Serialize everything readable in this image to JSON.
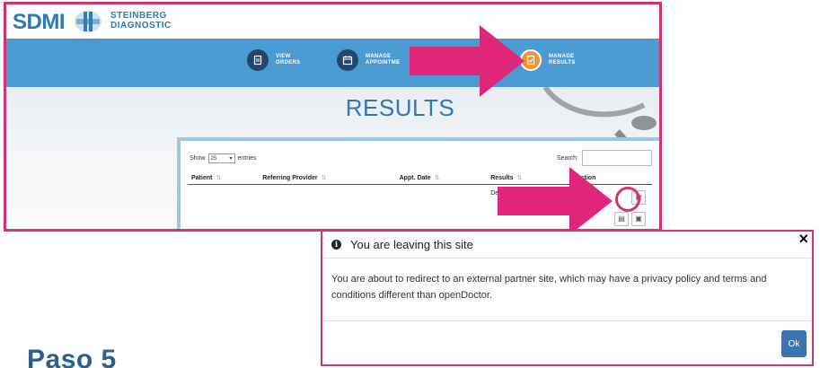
{
  "brand": {
    "name": "SDMI",
    "sub_line1": "STEINBERG",
    "sub_line2": "DIAGNOSTIC"
  },
  "nav": {
    "items": [
      {
        "line1": "VIEW",
        "line2": "ORDERS",
        "icon": "document-icon",
        "active": false
      },
      {
        "line1": "MANAGE",
        "line2": "APPOINTME",
        "icon": "calendar-icon",
        "active": false
      },
      {
        "line1": "MANAGE",
        "line2": "RESULTS",
        "icon": "results-icon",
        "active": true
      }
    ]
  },
  "page": {
    "title": "RESULTS"
  },
  "table": {
    "show_label": "Show",
    "entries_value": "25",
    "entries_label": "entries",
    "search_label": "Search:",
    "columns": [
      "Patient",
      "Referring Provider",
      "Appt. Date",
      "Results",
      "Action"
    ],
    "rows": [
      {
        "patient": "",
        "provider": "",
        "date": "",
        "results": "Dexa, Axial S"
      }
    ]
  },
  "modal": {
    "title": "You are leaving this site",
    "body": "You are about to redirect to an external partner site, which may have a privacy policy and terms and conditions different than openDoctor.",
    "close_label": "×",
    "ok_label": "Ok"
  },
  "step": {
    "title": "Paso 5"
  },
  "colors": {
    "highlight": "#d6336c",
    "nav_blue": "#4a9bd1",
    "brand_blue": "#2f79b5",
    "active_orange": "#f0952d",
    "ok_blue": "#3b74b1"
  }
}
